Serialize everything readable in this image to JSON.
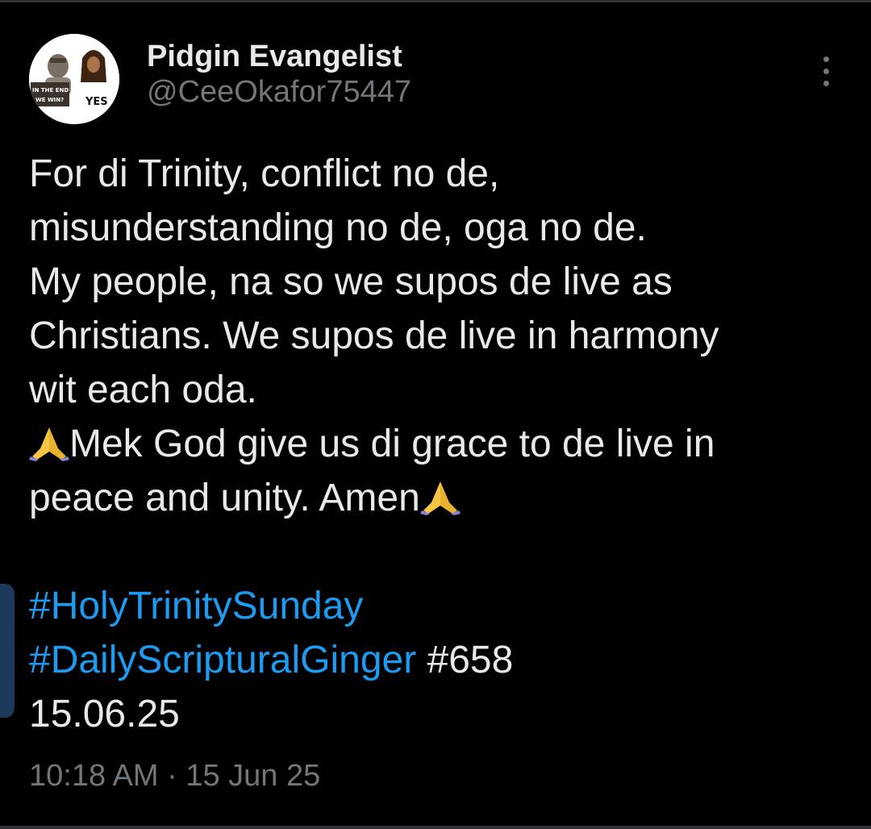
{
  "author": {
    "display_name": "Pidgin Evangelist",
    "handle": "@CeeOkafor75447",
    "avatar": {
      "caption_left": "IN THE END WE WIN?",
      "caption_right": "YES"
    }
  },
  "tweet": {
    "lines": [
      "For di Trinity, conflict no de,",
      "misunderstanding no de, oga no de.",
      "My people, na so we supos de live as",
      "Christians. We supos de live in harmony",
      "wit each oda.",
      "Mek God give us di grace to de live in",
      "peace and unity. Amen"
    ],
    "hashtags": [
      "#HolyTrinitySunday",
      "#DailyScripturalGinger"
    ],
    "number_tag": "#658",
    "date_line": "15.06.25",
    "emoji": "praying-hands"
  },
  "meta": {
    "time": "10:18 AM",
    "separator": "·",
    "date": "15 Jun 25"
  },
  "colors": {
    "background": "#000000",
    "text": "#e7e9ea",
    "muted": "#71767b",
    "link": "#1d9bf0"
  }
}
